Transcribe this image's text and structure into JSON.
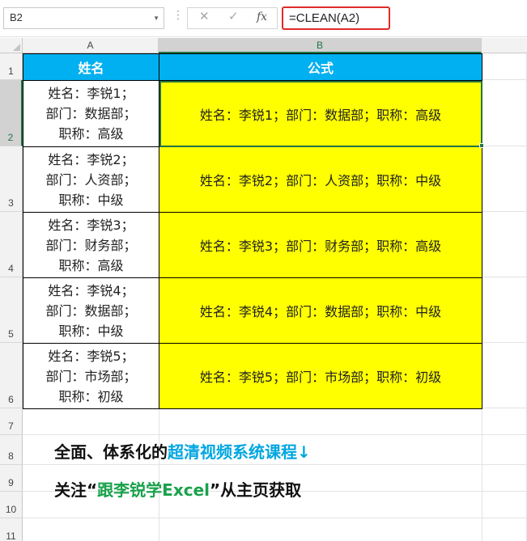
{
  "formula_bar": {
    "name_box": "B2",
    "cancel_icon": "close-icon",
    "enter_icon": "check-icon",
    "fx_label": "fx",
    "formula": "=CLEAN(A2)"
  },
  "columns": [
    "A",
    "B"
  ],
  "row_numbers": [
    "1",
    "2",
    "3",
    "4",
    "5",
    "6",
    "7",
    "8",
    "9",
    "10",
    "11"
  ],
  "header_row": {
    "a": "姓名",
    "b": "公式"
  },
  "rows": [
    {
      "a_lines": [
        "姓名：李锐1；",
        "部门：数据部；",
        "职称：高级"
      ],
      "b": "姓名：李锐1；部门：数据部；职称：高级"
    },
    {
      "a_lines": [
        "姓名：李锐2；",
        "部门：人资部；",
        "职称：中级"
      ],
      "b": "姓名：李锐2；部门：人资部；职称：中级"
    },
    {
      "a_lines": [
        "姓名：李锐3；",
        "部门：财务部；",
        "职称：高级"
      ],
      "b": "姓名：李锐3；部门：财务部；职称：高级"
    },
    {
      "a_lines": [
        "姓名：李锐4；",
        "部门：数据部；",
        "职称：中级"
      ],
      "b": "姓名：李锐4；部门：数据部；职称：中级"
    },
    {
      "a_lines": [
        "姓名：李锐5；",
        "部门：市场部；",
        "职称：初级"
      ],
      "b": "姓名：李锐5；部门：市场部；职称：初级"
    }
  ],
  "promo": {
    "line1_part1": "全面、体系化的",
    "line1_part2": "超清视频系统课程",
    "line1_arrow": "↓",
    "line2_part1": "关注“",
    "line2_part2": "跟李锐学Excel",
    "line2_part3": "”从主页获取"
  },
  "colors": {
    "header_fill": "#00b0f0",
    "result_fill": "#ffff00",
    "selection": "#217346",
    "formula_highlight": "#e02a2a",
    "promo_blue": "#00a6e0",
    "promo_green": "#19a14b"
  }
}
